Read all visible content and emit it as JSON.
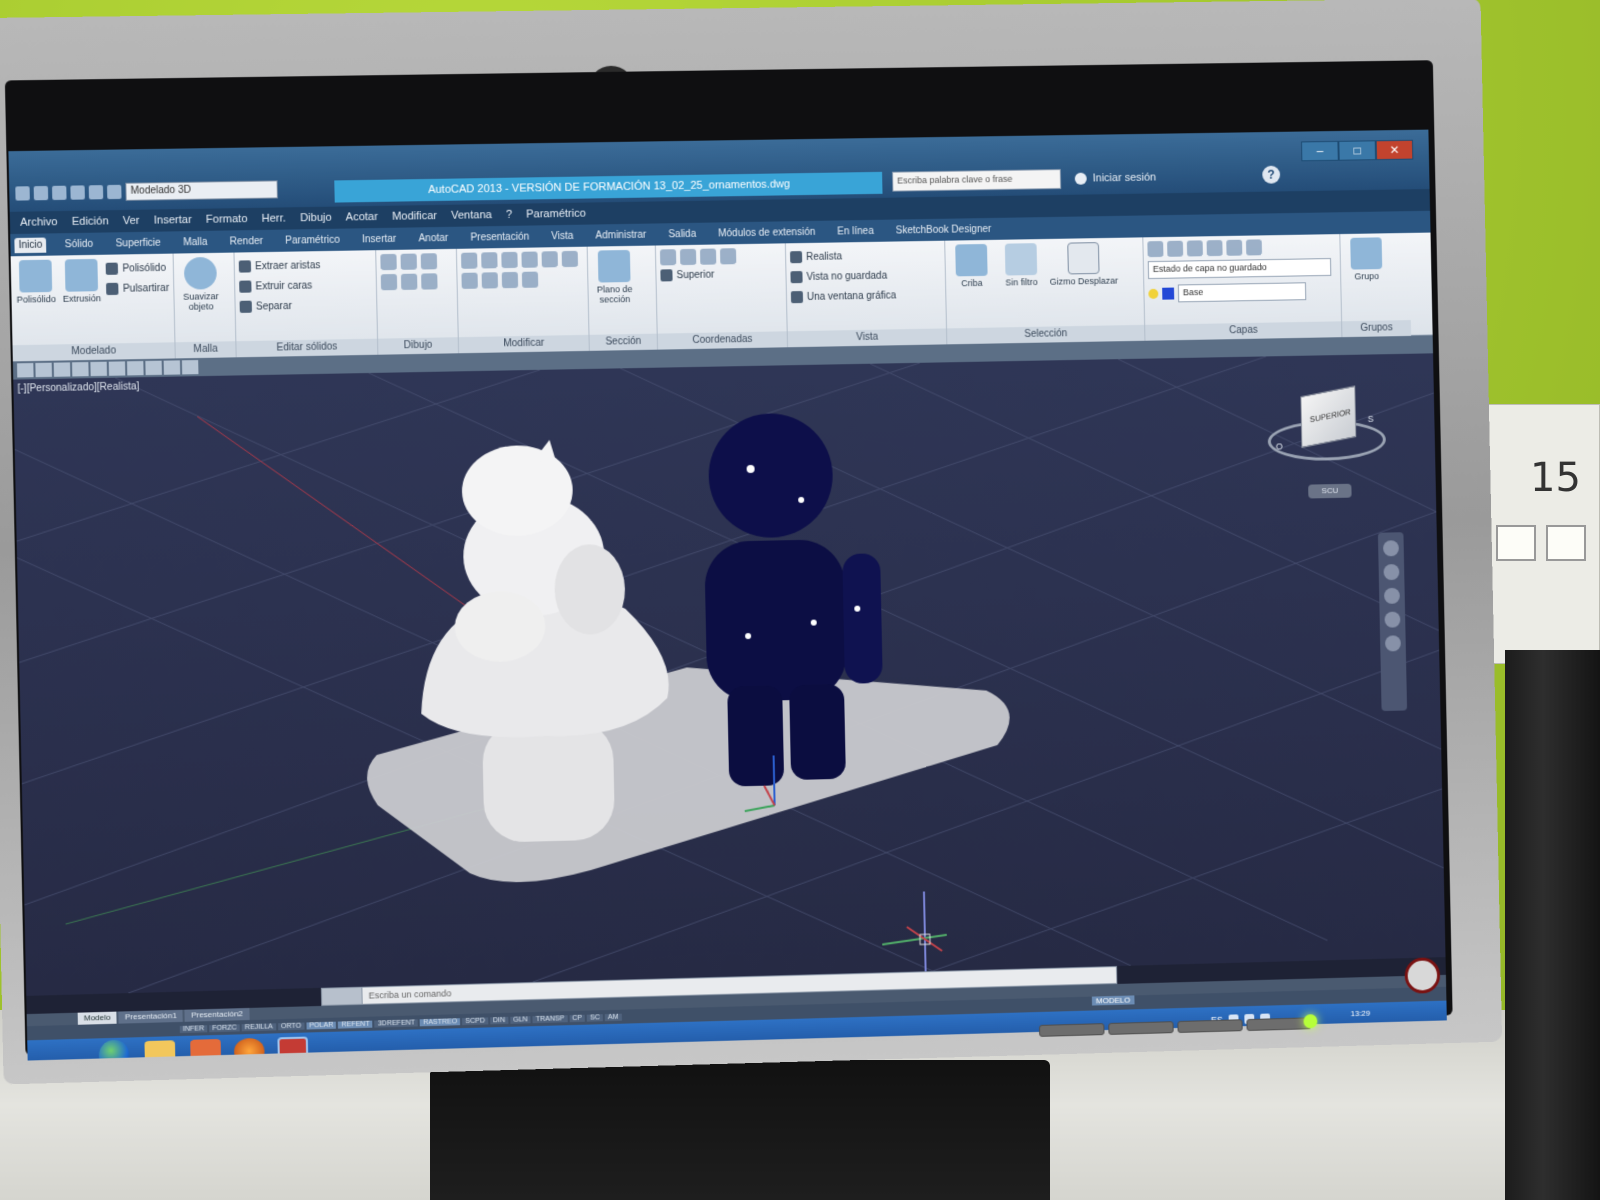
{
  "app": {
    "title": "AutoCAD 2013 - VERSIÓN DE FORMACIÓN   13_02_25_ornamentos.dwg",
    "workspace": "Modelado 3D",
    "search_placeholder": "Escriba palabra clave o frase",
    "signin_label": "Iniciar sesión",
    "help_label": "?",
    "window_controls": {
      "minimize": "–",
      "maximize": "□",
      "close": "✕"
    }
  },
  "menubar": {
    "items": [
      "Archivo",
      "Edición",
      "Ver",
      "Insertar",
      "Formato",
      "Herr.",
      "Dibujo",
      "Acotar",
      "Modificar",
      "Ventana",
      "?",
      "Paramétrico"
    ]
  },
  "ribbon_tabs": {
    "items": [
      "Inicio",
      "Sólido",
      "Superficie",
      "Malla",
      "Render",
      "Paramétrico",
      "Insertar",
      "Anotar",
      "Presentación",
      "Vista",
      "Administrar",
      "Salida",
      "Módulos de extensión",
      "En línea",
      "SketchBook Designer"
    ],
    "active_index": 0
  },
  "ribbon": {
    "panels": [
      {
        "title": "Modelado",
        "big_tools": [
          "Polisólido",
          "Extrusión"
        ],
        "tools": [
          "Polisólido",
          "Pulsartirar"
        ]
      },
      {
        "title": "Malla",
        "big_tools": [
          "Suavizar objeto"
        ]
      },
      {
        "title": "Editar sólidos",
        "rows": [
          "Extraer aristas",
          "Extruir caras",
          "Separar"
        ]
      },
      {
        "title": "Dibujo"
      },
      {
        "title": "Modificar"
      },
      {
        "title": "Sección",
        "big_tools": [
          "Plano de sección"
        ]
      },
      {
        "title": "Coordenadas",
        "rows": [
          "Superior"
        ]
      },
      {
        "title": "Vista",
        "rows": [
          "Realista",
          "Vista no guardada",
          "Una ventana gráfica"
        ]
      },
      {
        "title": "Selección",
        "big_tools": [
          "Criba",
          "Sin filtro",
          "Gizmo Desplazar"
        ]
      },
      {
        "title": "Capas",
        "layer_state": "Estado de capa no guardado",
        "current_layer": "Base"
      },
      {
        "title": "Grupos",
        "big_tools": [
          "Grupo"
        ]
      }
    ]
  },
  "viewport": {
    "label": "[-][Personalizado][Realista]",
    "viewcube_face": "SUPERIOR",
    "compass": {
      "south": "S",
      "west": "O"
    },
    "wcs": "SCU",
    "background": "#2c3150",
    "grid_color": "#4d5577",
    "objects": [
      "white-mushroom-ornament",
      "dark-blue-figure",
      "grey-base-plate"
    ]
  },
  "command_line": {
    "placeholder": "Escriba un comando"
  },
  "layout_tabs": {
    "items": [
      "Modelo",
      "Presentación1",
      "Presentación2"
    ],
    "active_index": 0
  },
  "statusbar": {
    "toggles": [
      "INFER",
      "FORZC",
      "REJILLA",
      "ORTO",
      "POLAR",
      "REFENT",
      "3DREFENT",
      "RASTREO",
      "SCPD",
      "DIN",
      "GLN",
      "TRANSP",
      "CP",
      "SC",
      "AM"
    ],
    "active": [
      "POLAR",
      "REFENT",
      "RASTREO"
    ],
    "model_indicator": "MODELO"
  },
  "taskbar": {
    "apps": [
      "windows-start",
      "explorer",
      "media-player",
      "firefox",
      "autocad"
    ],
    "language": "ES",
    "time": "13:29",
    "date": "26/02/2013"
  },
  "physical": {
    "wall_label": "15",
    "accent_wall": "#a6ca2f"
  }
}
